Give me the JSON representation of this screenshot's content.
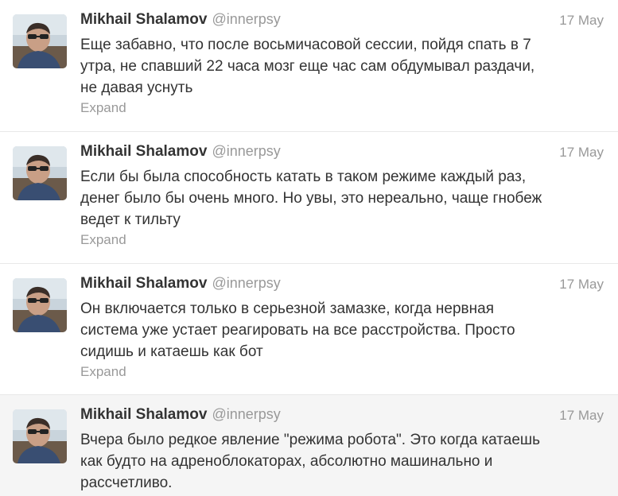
{
  "tweets": [
    {
      "name": "Mikhail Shalamov",
      "handle": "@innerpsy",
      "date": "17 May",
      "text": "Еще забавно, что после восьмичасовой сессии, пойдя спать в 7\nутра, не спавший 22 часа мозг еще час сам обдумывал раздачи,\nне давая уснуть",
      "expand": "Expand",
      "avatar_icon": "user-avatar-icon"
    },
    {
      "name": "Mikhail Shalamov",
      "handle": "@innerpsy",
      "date": "17 May",
      "text": "Если бы была способность катать в таком режиме каждый раз,\nденег было бы очень много. Но увы, это нереально, чаще гнобеж\nведет к тильту",
      "expand": "Expand",
      "avatar_icon": "user-avatar-icon"
    },
    {
      "name": "Mikhail Shalamov",
      "handle": "@innerpsy",
      "date": "17 May",
      "text": "Он включается только в серьезной замазке, когда нервная\nсистема уже устает реагировать на все расстройства. Просто\nсидишь и катаешь как бот",
      "expand": "Expand",
      "avatar_icon": "user-avatar-icon"
    },
    {
      "name": "Mikhail Shalamov",
      "handle": "@innerpsy",
      "date": "17 May",
      "text": "Вчера было редкое явление \"режима робота\". Это когда катаешь\nкак будто на адреноблокаторах, абсолютно машинально и\nрассчетливо.",
      "expand": "",
      "avatar_icon": "user-avatar-icon"
    }
  ],
  "colors": {
    "name": "#333333",
    "muted": "#999999",
    "border": "#e8e8e8",
    "hover_bg": "#f5f5f5"
  }
}
